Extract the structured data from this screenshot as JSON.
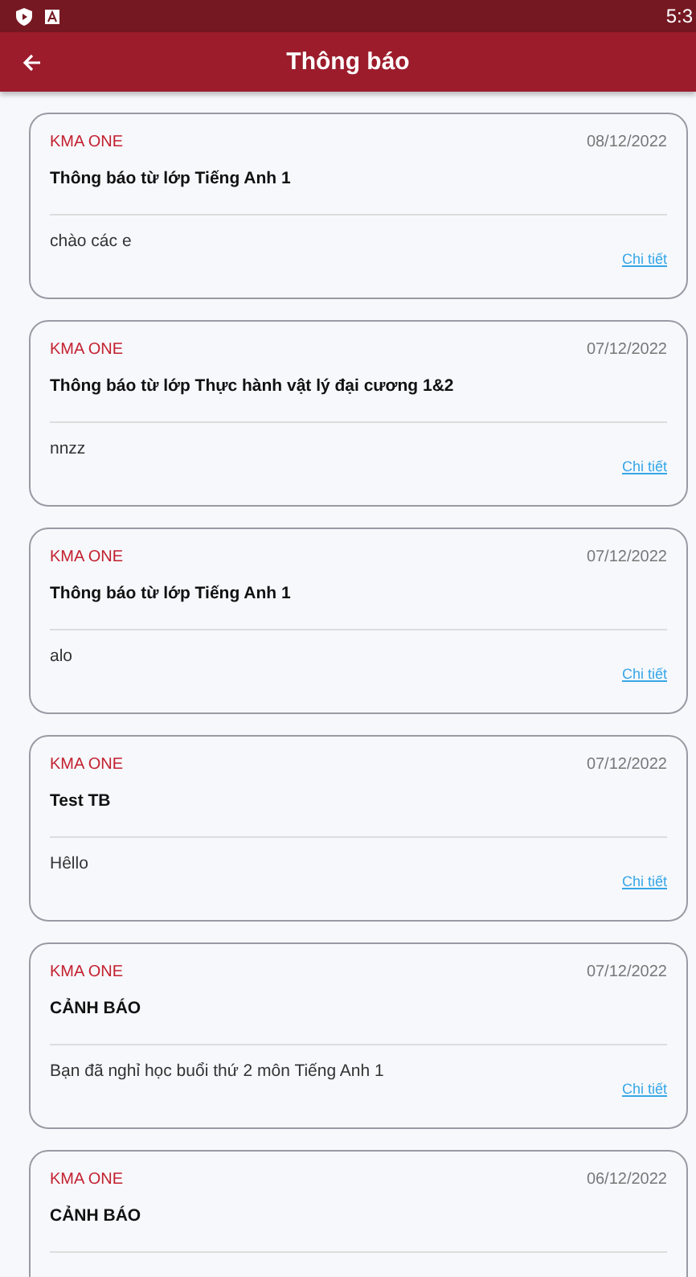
{
  "status_bar": {
    "time": "5:3"
  },
  "app_bar": {
    "title": "Thông báo"
  },
  "notifications": [
    {
      "source": "KMA ONE",
      "date": "08/12/2022",
      "title": "Thông báo từ lớp Tiếng Anh 1",
      "body": "chào các e",
      "link": "Chi tiết"
    },
    {
      "source": "KMA ONE",
      "date": "07/12/2022",
      "title": "Thông báo từ lớp Thực hành vật lý đại cương 1&2",
      "body": "nnzz",
      "link": "Chi tiết"
    },
    {
      "source": "KMA ONE",
      "date": "07/12/2022",
      "title": "Thông báo từ lớp Tiếng Anh 1",
      "body": "alo",
      "link": "Chi tiết"
    },
    {
      "source": "KMA ONE",
      "date": "07/12/2022",
      "title": "Test TB",
      "body": "Hêllo",
      "link": "Chi tiết"
    },
    {
      "source": "KMA ONE",
      "date": "07/12/2022",
      "title": "CẢNH BÁO",
      "body": "Bạn đã nghỉ học buổi thứ 2 môn Tiếng Anh 1",
      "link": "Chi tiết"
    },
    {
      "source": "KMA ONE",
      "date": "06/12/2022",
      "title": "CẢNH BÁO"
    }
  ]
}
